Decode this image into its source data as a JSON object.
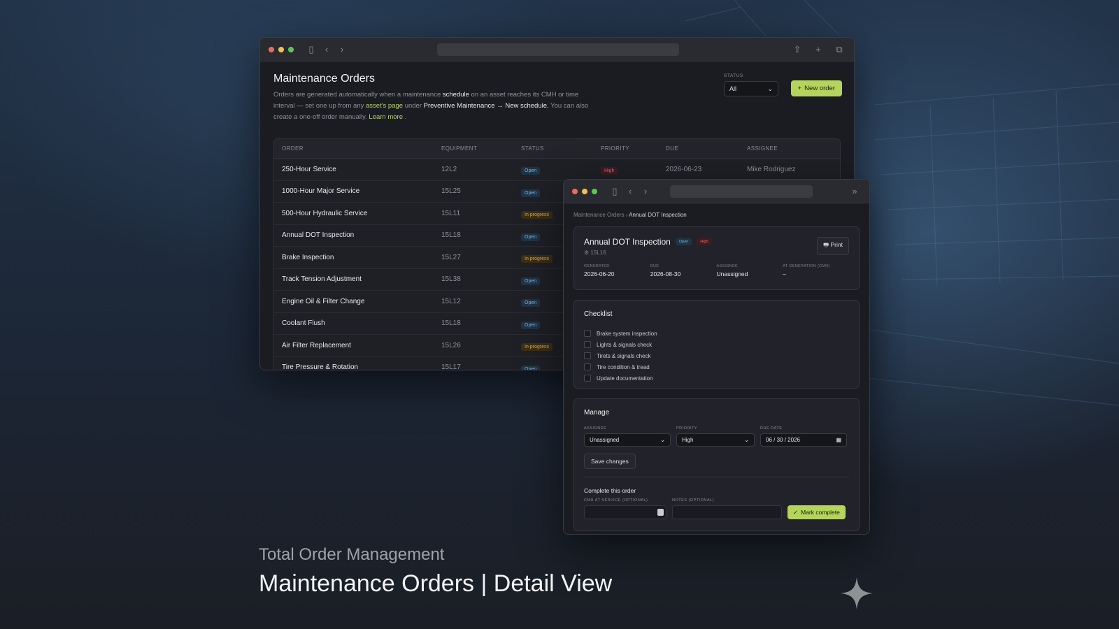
{
  "main_window": {
    "title": "Maintenance Orders",
    "description": {
      "p1": "Orders are generated automatically when a maintenance ",
      "hl1": "schedule",
      "p2": " on an asset reaches its CMH or time interval — set one up from any ",
      "link1": "asset's page",
      "p3": " under ",
      "hl2": "Preventive Maintenance → New schedule.",
      "p4": " You can also create a one-off order manually. ",
      "link2": "Learn more",
      "p5": " ."
    },
    "status_label": "STATUS",
    "status_value": "All",
    "new_order_label": "New order",
    "columns": [
      "ORDER",
      "EQUIPMENT",
      "STATUS",
      "PRIORITY",
      "DUE",
      "ASSIGNEE"
    ],
    "rows": [
      {
        "order": "250-Hour Service",
        "equipment": "12L2",
        "status": "Open",
        "priority": "High",
        "due": "2026-06-23",
        "assignee": "Mike Rodriguez"
      },
      {
        "order": "1000-Hour Major Service",
        "equipment": "15L25",
        "status": "Open"
      },
      {
        "order": "500-Hour Hydraulic Service",
        "equipment": "15L11",
        "status": "In progress"
      },
      {
        "order": "Annual DOT Inspection",
        "equipment": "15L18",
        "status": "Open"
      },
      {
        "order": "Brake Inspection",
        "equipment": "15L27",
        "status": "In progress"
      },
      {
        "order": "Track Tension Adjustment",
        "equipment": "15L38",
        "status": "Open"
      },
      {
        "order": "Engine Oil & Filter Change",
        "equipment": "15L12",
        "status": "Open"
      },
      {
        "order": "Coolant Flush",
        "equipment": "15L18",
        "status": "Open"
      },
      {
        "order": "Air Filter Replacement",
        "equipment": "15L26",
        "status": "In progress"
      },
      {
        "order": "Tire Pressure & Rotation",
        "equipment": "15L17",
        "status": "Open"
      }
    ]
  },
  "detail_window": {
    "breadcrumb_parent": "Maintenance Orders",
    "breadcrumb_current": "Annual DOT Inspection",
    "title": "Annual DOT Inspection",
    "status_badge": "Open",
    "priority_badge": "High",
    "equipment": "15L16",
    "print_label": "Print",
    "meta": [
      {
        "key": "GENERATED",
        "value": "2026-06-20"
      },
      {
        "key": "DUE",
        "value": "2026-08-30"
      },
      {
        "key": "ASSIGNEE",
        "value": "Unassigned"
      },
      {
        "key": "AT GENERATION (CMH)",
        "value": "–"
      }
    ],
    "checklist_title": "Checklist",
    "checklist": [
      "Brake system inspection",
      "Lights & signals check",
      "Tirets & signals check",
      "Tire condition & tread",
      "Update documentation"
    ],
    "manage_title": "Manage",
    "assignee_label": "ASSIGNEE",
    "assignee_value": "Unassigned",
    "priority_label": "PRIORITY",
    "priority_value": "High",
    "due_label": "DUE DATE",
    "due_value": "06 / 30 / 2026",
    "save_label": "Save changes",
    "complete_title": "Complete this order",
    "cmh_label": "CMH AT SERVICE (OPTIONAL)",
    "notes_label": "NOTES (OPTIONAL)",
    "mark_complete_label": "Mark complete"
  },
  "caption": {
    "subtitle": "Total Order Management",
    "title": "Maintenance Orders | Detail View"
  },
  "colors": {
    "accent": "#b5d45c",
    "open_badge": "#7db6e6",
    "progress_badge": "#e0ad4a",
    "high_badge": "#e3656f"
  }
}
